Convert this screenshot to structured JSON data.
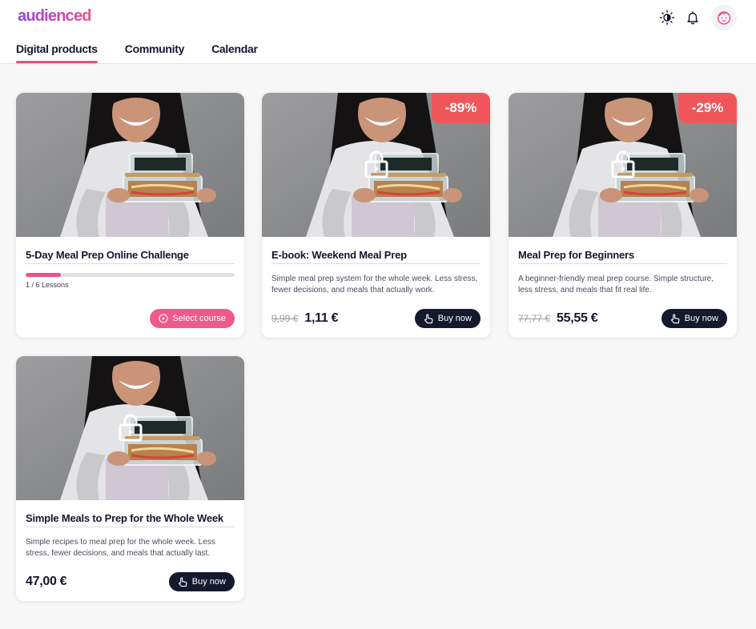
{
  "header": {
    "logo": "audienced",
    "icons": [
      "theme-toggle-icon",
      "bell-icon",
      "avatar-face-icon"
    ]
  },
  "tabs": [
    {
      "label": "Digital products",
      "active": true
    },
    {
      "label": "Community",
      "active": false
    },
    {
      "label": "Calendar",
      "active": false
    }
  ],
  "colors": {
    "accent": "#ef4f86",
    "discount": "#f05659",
    "dark_button": "#14192e"
  },
  "products": [
    {
      "title": "5-Day Meal Prep Online Challenge",
      "progress": 0.17,
      "lessons_text": "1 / 6 Lessons",
      "button_label": "Select course",
      "locked": false
    },
    {
      "title": "E-book: Weekend Meal Prep",
      "discount": "-89%",
      "description": "Simple meal prep system for the whole week. Less stress, fewer decisions, and meals that actually work.",
      "old_price": "9,99 €",
      "price": "1,11 €",
      "button_label": "Buy now",
      "locked": true
    },
    {
      "title": "Meal Prep for Beginners",
      "discount": "-29%",
      "description": "A beginner-friendly meal prep course. Simple structure, less stress, and meals that fit real life.",
      "old_price": "77,77 €",
      "price": "55,55 €",
      "button_label": "Buy now",
      "locked": true
    },
    {
      "title": "Simple Meals to Prep for the Whole Week",
      "description": "Simple recipes to meal prep for the whole week. Less stress, fewer decisions, and meals that actually last.",
      "price": "47,00 €",
      "button_label": "Buy now",
      "locked": true
    }
  ]
}
